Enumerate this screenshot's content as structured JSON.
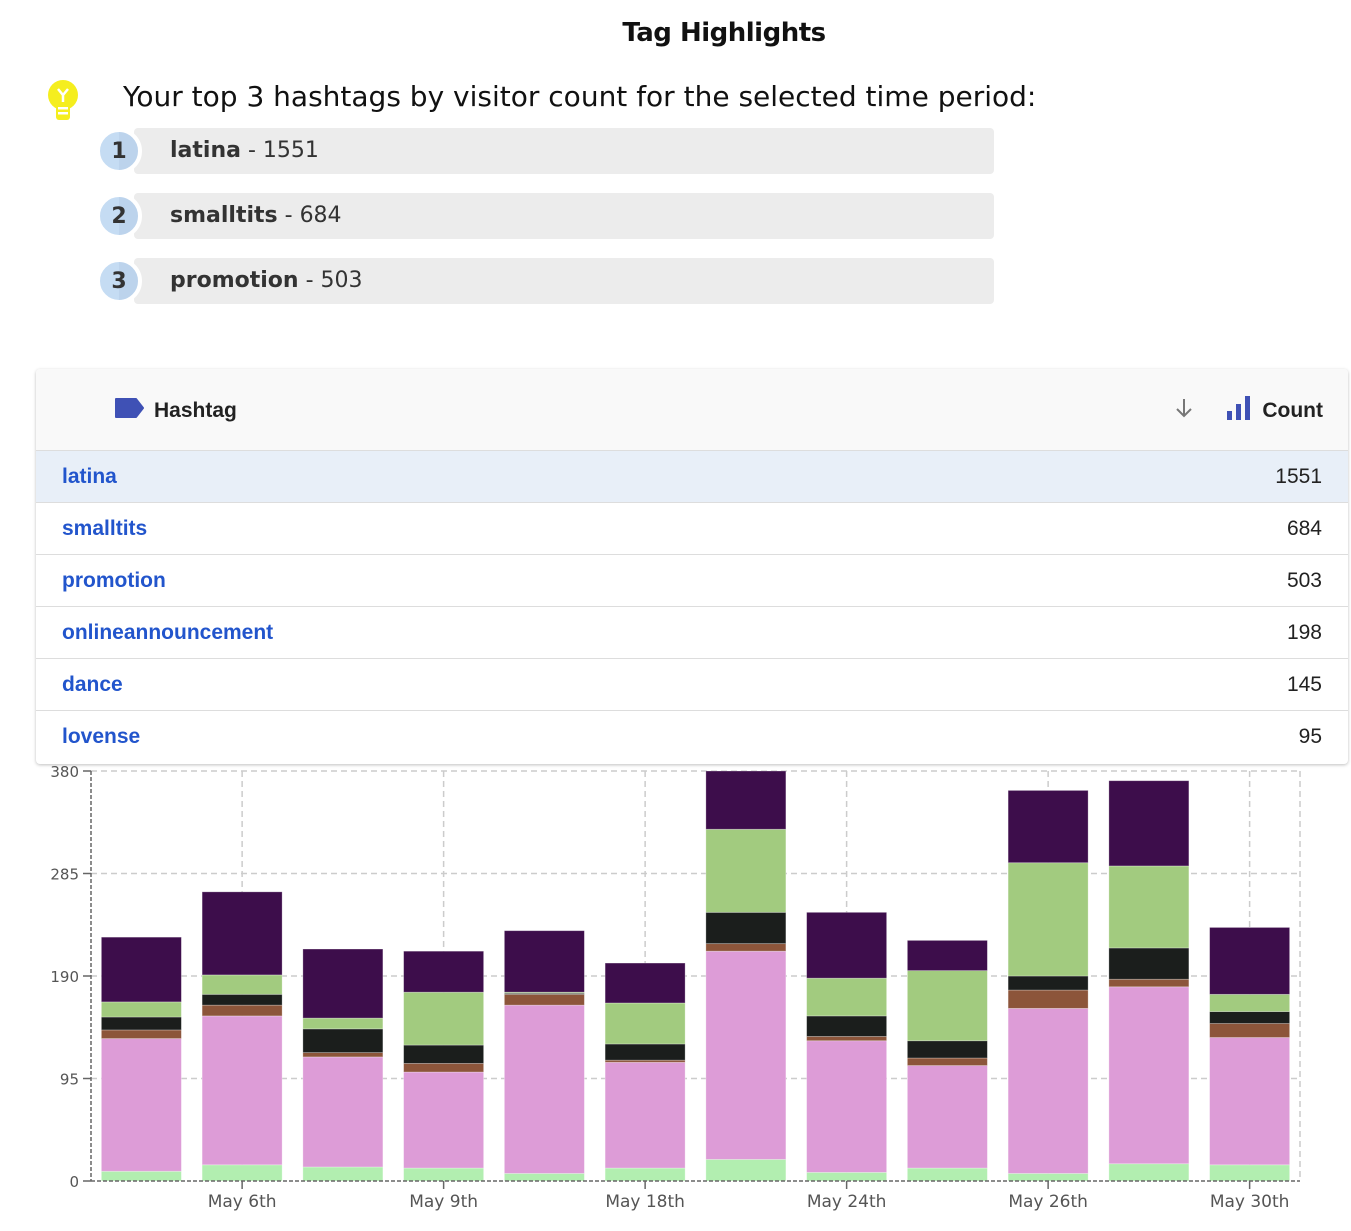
{
  "header": {
    "title": "Tag Highlights",
    "intro": "Your top 3 hashtags by visitor count for the selected time period:",
    "icon": "lightbulb-icon"
  },
  "top_hashtags": [
    {
      "rank": "1",
      "tag": "latina",
      "sep": " - ",
      "count": "1551"
    },
    {
      "rank": "2",
      "tag": "smalltits",
      "sep": " - ",
      "count": "684"
    },
    {
      "rank": "3",
      "tag": "promotion",
      "sep": " - ",
      "count": "503"
    }
  ],
  "table": {
    "columns": {
      "hashtag": "Hashtag",
      "count": "Count"
    },
    "icons": {
      "hashtag": "label-tag-icon",
      "sort": "arrow-down-icon",
      "count": "bar-chart-icon"
    },
    "rows": [
      {
        "tag": "latina",
        "count": "1551"
      },
      {
        "tag": "smalltits",
        "count": "684"
      },
      {
        "tag": "promotion",
        "count": "503"
      },
      {
        "tag": "onlineannouncement",
        "count": "198"
      },
      {
        "tag": "dance",
        "count": "145"
      },
      {
        "tag": "lovense",
        "count": "95"
      }
    ],
    "accent": "#3f51b5",
    "link_color": "#2255cc"
  },
  "chart_data": {
    "type": "bar",
    "stacked": true,
    "title": "",
    "xlabel": "",
    "ylabel": "",
    "ylim": [
      0,
      380
    ],
    "yticks": [
      0,
      95,
      190,
      285,
      380
    ],
    "grid": true,
    "categories": [
      "",
      "May 6th",
      "",
      "May 9th",
      "",
      "May 18th",
      "",
      "May 24th",
      "",
      "May 26th",
      "",
      "May 30th"
    ],
    "series": [
      {
        "name": "series-1",
        "color": "#b2eeb0",
        "values": [
          9,
          15,
          13,
          12,
          7,
          12,
          20,
          8,
          12,
          7,
          16,
          15
        ]
      },
      {
        "name": "series-2",
        "color": "#dd9cd7",
        "values": [
          123,
          138,
          102,
          89,
          156,
          98,
          193,
          122,
          95,
          153,
          164,
          118
        ]
      },
      {
        "name": "series-3",
        "color": "#8c553a",
        "values": [
          8,
          10,
          4,
          8,
          10,
          2,
          7,
          4,
          7,
          17,
          7,
          13
        ]
      },
      {
        "name": "series-4",
        "color": "#1b1e1c",
        "values": [
          12,
          10,
          22,
          17,
          1,
          15,
          29,
          19,
          16,
          13,
          29,
          11
        ]
      },
      {
        "name": "series-5",
        "color": "#a2cb7f",
        "values": [
          14,
          18,
          10,
          49,
          1,
          38,
          77,
          35,
          65,
          105,
          76,
          16
        ]
      },
      {
        "name": "series-6",
        "color": "#3d0d4b",
        "values": [
          60,
          77,
          64,
          38,
          57,
          37,
          54,
          61,
          28,
          67,
          79,
          62
        ]
      }
    ]
  }
}
